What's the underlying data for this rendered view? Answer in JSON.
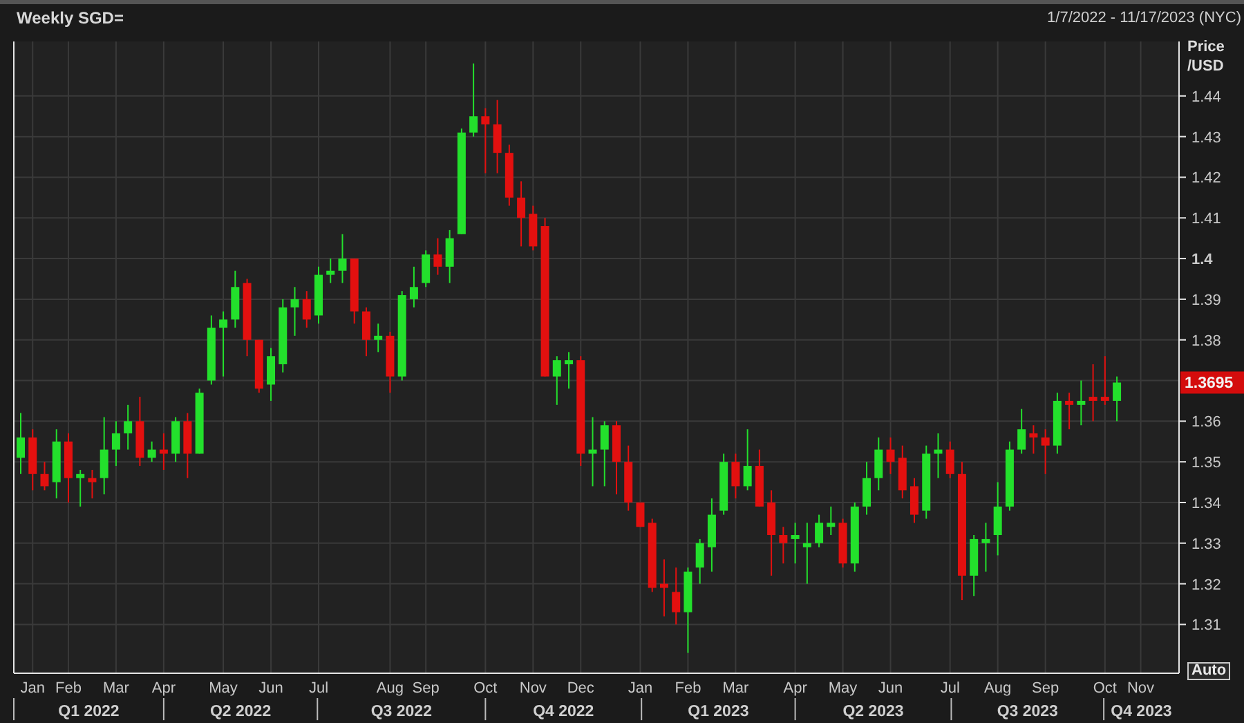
{
  "header": {
    "title": "Weekly SGD=",
    "date_range": "1/7/2022 - 11/17/2023 (NYC)"
  },
  "chart": {
    "auto_button": "Auto",
    "chart_data": {
      "type": "candlestick",
      "grid": true,
      "ylabel": "Price /USD",
      "ylim": [
        1.298,
        1.4534
      ],
      "yticks": [
        1.31,
        1.32,
        1.33,
        1.34,
        1.35,
        1.36,
        1.38,
        1.39,
        {
          "value": 1.4,
          "label": "1.4"
        },
        1.41,
        1.42,
        1.43,
        1.44
      ],
      "categories": [
        null,
        "Jan",
        null,
        null,
        "Feb",
        null,
        null,
        null,
        "Mar",
        null,
        null,
        null,
        "Apr",
        null,
        null,
        null,
        null,
        "May",
        null,
        null,
        null,
        "Jun",
        null,
        null,
        null,
        "Jul",
        null,
        null,
        null,
        null,
        null,
        "Aug",
        null,
        null,
        "Sep",
        null,
        null,
        null,
        null,
        "Oct",
        null,
        null,
        null,
        "Nov",
        null,
        null,
        null,
        "Dec",
        null,
        null,
        null,
        null,
        "Jan",
        null,
        null,
        null,
        "Feb",
        null,
        null,
        null,
        "Mar",
        null,
        null,
        null,
        null,
        "Apr",
        null,
        null,
        null,
        "May",
        null,
        null,
        null,
        "Jun",
        null,
        null,
        null,
        null,
        "Jul",
        null,
        null,
        null,
        "Aug",
        null,
        null,
        null,
        "Sep",
        null,
        null,
        null,
        null,
        "Oct",
        null,
        null,
        "Nov"
      ],
      "ohlc": [
        [
          1.351,
          1.362,
          1.347,
          1.356
        ],
        [
          1.356,
          1.358,
          1.343,
          1.347
        ],
        [
          1.347,
          1.35,
          1.343,
          1.344
        ],
        [
          1.345,
          1.358,
          1.341,
          1.355
        ],
        [
          1.355,
          1.357,
          1.34,
          1.346
        ],
        [
          1.346,
          1.348,
          1.339,
          1.347
        ],
        [
          1.346,
          1.348,
          1.341,
          1.345
        ],
        [
          1.346,
          1.361,
          1.342,
          1.353
        ],
        [
          1.353,
          1.36,
          1.349,
          1.357
        ],
        [
          1.357,
          1.364,
          1.353,
          1.36
        ],
        [
          1.36,
          1.366,
          1.349,
          1.351
        ],
        [
          1.351,
          1.355,
          1.35,
          1.353
        ],
        [
          1.353,
          1.357,
          1.348,
          1.352
        ],
        [
          1.352,
          1.361,
          1.35,
          1.36
        ],
        [
          1.36,
          1.362,
          1.346,
          1.352
        ],
        [
          1.352,
          1.368,
          1.352,
          1.367
        ],
        [
          1.37,
          1.386,
          1.369,
          1.383
        ],
        [
          1.383,
          1.387,
          1.371,
          1.385
        ],
        [
          1.385,
          1.397,
          1.383,
          1.393
        ],
        [
          1.394,
          1.395,
          1.376,
          1.38
        ],
        [
          1.38,
          1.38,
          1.367,
          1.368
        ],
        [
          1.369,
          1.378,
          1.365,
          1.376
        ],
        [
          1.374,
          1.39,
          1.372,
          1.388
        ],
        [
          1.388,
          1.393,
          1.381,
          1.39
        ],
        [
          1.39,
          1.392,
          1.383,
          1.385
        ],
        [
          1.386,
          1.398,
          1.384,
          1.396
        ],
        [
          1.396,
          1.4,
          1.394,
          1.397
        ],
        [
          1.397,
          1.406,
          1.394,
          1.4
        ],
        [
          1.4,
          1.4,
          1.384,
          1.387
        ],
        [
          1.387,
          1.388,
          1.376,
          1.38
        ],
        [
          1.38,
          1.384,
          1.377,
          1.381
        ],
        [
          1.381,
          1.382,
          1.367,
          1.371
        ],
        [
          1.371,
          1.392,
          1.37,
          1.391
        ],
        [
          1.39,
          1.398,
          1.388,
          1.393
        ],
        [
          1.394,
          1.402,
          1.393,
          1.401
        ],
        [
          1.401,
          1.405,
          1.396,
          1.398
        ],
        [
          1.398,
          1.407,
          1.394,
          1.405
        ],
        [
          1.406,
          1.432,
          1.406,
          1.431
        ],
        [
          1.431,
          1.448,
          1.43,
          1.435
        ],
        [
          1.435,
          1.437,
          1.421,
          1.433
        ],
        [
          1.433,
          1.439,
          1.421,
          1.426
        ],
        [
          1.426,
          1.428,
          1.413,
          1.415
        ],
        [
          1.415,
          1.419,
          1.403,
          1.41
        ],
        [
          1.411,
          1.413,
          1.402,
          1.403
        ],
        [
          1.408,
          1.41,
          1.371,
          1.371
        ],
        [
          1.371,
          1.376,
          1.364,
          1.375
        ],
        [
          1.374,
          1.377,
          1.368,
          1.375
        ],
        [
          1.375,
          1.376,
          1.349,
          1.352
        ],
        [
          1.352,
          1.361,
          1.344,
          1.353
        ],
        [
          1.353,
          1.36,
          1.344,
          1.359
        ],
        [
          1.359,
          1.36,
          1.342,
          1.35
        ],
        [
          1.35,
          1.354,
          1.338,
          1.34
        ],
        [
          1.34,
          1.34,
          1.334,
          1.334
        ],
        [
          1.335,
          1.336,
          1.318,
          1.319
        ],
        [
          1.32,
          1.326,
          1.312,
          1.319
        ],
        [
          1.318,
          1.324,
          1.31,
          1.313
        ],
        [
          1.313,
          1.324,
          1.303,
          1.323
        ],
        [
          1.324,
          1.331,
          1.32,
          1.33
        ],
        [
          1.329,
          1.341,
          1.323,
          1.337
        ],
        [
          1.338,
          1.352,
          1.337,
          1.35
        ],
        [
          1.35,
          1.352,
          1.341,
          1.344
        ],
        [
          1.344,
          1.358,
          1.343,
          1.349
        ],
        [
          1.349,
          1.353,
          1.339,
          1.339
        ],
        [
          1.34,
          1.343,
          1.322,
          1.332
        ],
        [
          1.332,
          1.334,
          1.325,
          1.33
        ],
        [
          1.331,
          1.335,
          1.325,
          1.332
        ],
        [
          1.329,
          1.335,
          1.32,
          1.33
        ],
        [
          1.33,
          1.337,
          1.329,
          1.335
        ],
        [
          1.334,
          1.339,
          1.332,
          1.335
        ],
        [
          1.335,
          1.336,
          1.324,
          1.325
        ],
        [
          1.325,
          1.34,
          1.323,
          1.339
        ],
        [
          1.339,
          1.35,
          1.337,
          1.346
        ],
        [
          1.346,
          1.356,
          1.343,
          1.353
        ],
        [
          1.353,
          1.356,
          1.347,
          1.35
        ],
        [
          1.351,
          1.354,
          1.341,
          1.343
        ],
        [
          1.344,
          1.346,
          1.335,
          1.337
        ],
        [
          1.338,
          1.354,
          1.336,
          1.352
        ],
        [
          1.352,
          1.357,
          1.346,
          1.353
        ],
        [
          1.353,
          1.355,
          1.346,
          1.347
        ],
        [
          1.347,
          1.35,
          1.316,
          1.322
        ],
        [
          1.322,
          1.332,
          1.317,
          1.331
        ],
        [
          1.33,
          1.335,
          1.323,
          1.331
        ],
        [
          1.332,
          1.345,
          1.327,
          1.339
        ],
        [
          1.339,
          1.355,
          1.338,
          1.353
        ],
        [
          1.353,
          1.363,
          1.352,
          1.358
        ],
        [
          1.357,
          1.359,
          1.352,
          1.356
        ],
        [
          1.356,
          1.358,
          1.347,
          1.354
        ],
        [
          1.354,
          1.367,
          1.352,
          1.365
        ],
        [
          1.365,
          1.367,
          1.358,
          1.364
        ],
        [
          1.364,
          1.37,
          1.359,
          1.365
        ],
        [
          1.366,
          1.374,
          1.36,
          1.365
        ],
        [
          1.366,
          1.376,
          1.364,
          1.365
        ],
        [
          1.365,
          1.371,
          1.36,
          1.3695
        ],
        null,
        null
      ],
      "annotations": [
        "1.3695",
        "Q1 2022",
        "Q2 2022",
        "Q3 2022",
        "Q4 2022",
        "Q1 2023",
        "Q2 2023",
        "Q3 2023",
        "Q4 2023"
      ]
    }
  }
}
